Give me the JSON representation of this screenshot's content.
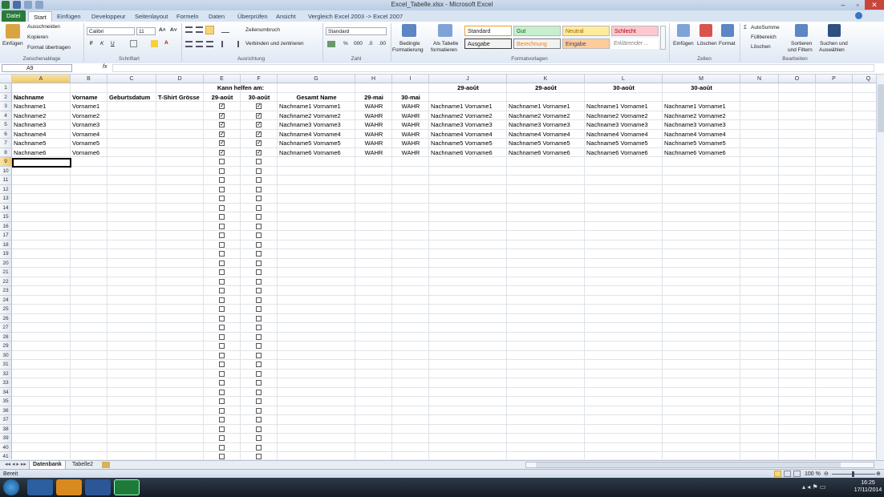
{
  "window": {
    "title": "Excel_Tabelle.xlsx - Microsoft Excel"
  },
  "tabs": [
    "Datei",
    "Start",
    "Einfügen",
    "Developpeur",
    "Seitenlayout",
    "Formeln",
    "Daten",
    "Überprüfen",
    "Ansicht",
    "Vergleich Excel 2003 -> Excel 2007"
  ],
  "ribbon": {
    "clipboard": {
      "paste": "Einfügen",
      "cut": "Ausschneiden",
      "copy": "Kopieren",
      "format": "Format übertragen",
      "label": "Zwischenablage"
    },
    "font": {
      "name": "Calibri",
      "size": "11",
      "bold": "F",
      "italic": "K",
      "underline": "U",
      "label": "Schriftart"
    },
    "align": {
      "wrap": "Zeilenumbruch",
      "merge": "Verbinden und zentrieren",
      "label": "Ausrichtung"
    },
    "number": {
      "format": "Standard",
      "percent": "%",
      "thousands": "000",
      "label": "Zahl"
    },
    "styles": {
      "cond1": "Bedingte",
      "cond2": "Formatierung",
      "astable1": "Als Tabelle",
      "astable2": "formatieren",
      "standard": "Standard",
      "gut": "Gut",
      "neutral": "Neutral",
      "schlecht": "Schlecht",
      "ausgabe": "Ausgabe",
      "berechnung": "Berechnung",
      "eingabe": "Eingabe",
      "erklaerend": "Erklärender ...",
      "label": "Formatvorlagen"
    },
    "cells": {
      "insert": "Einfügen",
      "delete": "Löschen",
      "format": "Format",
      "label": "Zellen"
    },
    "edit": {
      "autosum": "AutoSumme",
      "fill": "Füllbereich",
      "clear": "Löschen",
      "sort1": "Sortieren",
      "sort2": "und Filtern",
      "find1": "Suchen und",
      "find2": "Auswählen",
      "label": "Bearbeiten"
    }
  },
  "namebox": "A9",
  "fx": "fx",
  "columns": [
    "A",
    "B",
    "C",
    "D",
    "E",
    "F",
    "G",
    "H",
    "I",
    "J",
    "K",
    "L",
    "M",
    "N",
    "O",
    "P",
    "Q"
  ],
  "row1": {
    "ef": "Kann helfen am:",
    "j": "29-août",
    "k": "29-août",
    "l": "30-août",
    "m": "30-août"
  },
  "row2": [
    "Nachname",
    "Vorname",
    "Geburtsdatum",
    "T-Shirt Grösse",
    "29-août",
    "30-août",
    "Gesamt Name",
    "29-mai",
    "30-mai"
  ],
  "rows": [
    {
      "a": "Nachname1",
      "b": "Vorname1",
      "g": "Nachname1 Vorname1",
      "h": "WAHR",
      "i": "WAHR",
      "j": "Nachname1 Vorname1",
      "k": "Nachname1 Vorname1",
      "l": "Nachname1 Vorname1",
      "m": "Nachname1 Vorname1"
    },
    {
      "a": "Nachname2",
      "b": "Vorname2",
      "g": "Nachname2 Vorname2",
      "h": "WAHR",
      "i": "WAHR",
      "j": "Nachname2 Vorname2",
      "k": "Nachname2 Vorname2",
      "l": "Nachname2 Vorname2",
      "m": "Nachname2 Vorname2"
    },
    {
      "a": "Nachname3",
      "b": "Vorname3",
      "g": "Nachname3 Vorname3",
      "h": "WAHR",
      "i": "WAHR",
      "j": "Nachname3 Vorname3",
      "k": "Nachname3 Vorname3",
      "l": "Nachname3 Vorname3",
      "m": "Nachname3 Vorname3"
    },
    {
      "a": "Nachname4",
      "b": "Vorname4",
      "g": "Nachname4 Vorname4",
      "h": "WAHR",
      "i": "WAHR",
      "j": "Nachname4 Vorname4",
      "k": "Nachname4 Vorname4",
      "l": "Nachname4 Vorname4",
      "m": "Nachname4 Vorname4"
    },
    {
      "a": "Nachname5",
      "b": "Vorname5",
      "g": "Nachname5 Vorname5",
      "h": "WAHR",
      "i": "WAHR",
      "j": "Nachname5 Vorname5",
      "k": "Nachname5 Vorname5",
      "l": "Nachname5 Vorname5",
      "m": "Nachname5 Vorname5"
    },
    {
      "a": "Nachname6",
      "b": "Vorname6",
      "g": "Nachname6 Vorname6",
      "h": "WAHR",
      "i": "WAHR",
      "j": "Nachname6 Vorname6",
      "k": "Nachname6 Vorname6",
      "l": "Nachname6 Vorname6",
      "m": "Nachname6 Vorname6"
    }
  ],
  "checked_rows": 6,
  "sheets": [
    "Datenbank",
    "Tabelle2"
  ],
  "status": {
    "ready": "Bereit",
    "zoom": "100 %"
  },
  "clock": {
    "time": "16:25",
    "date": "17/11/2014"
  },
  "colors": {
    "excel_green": "#2a7a3a",
    "gut": "#c6efce",
    "neutral": "#ffeb9c",
    "schlecht": "#ffc7ce",
    "eingabe": "#ffcc99"
  }
}
